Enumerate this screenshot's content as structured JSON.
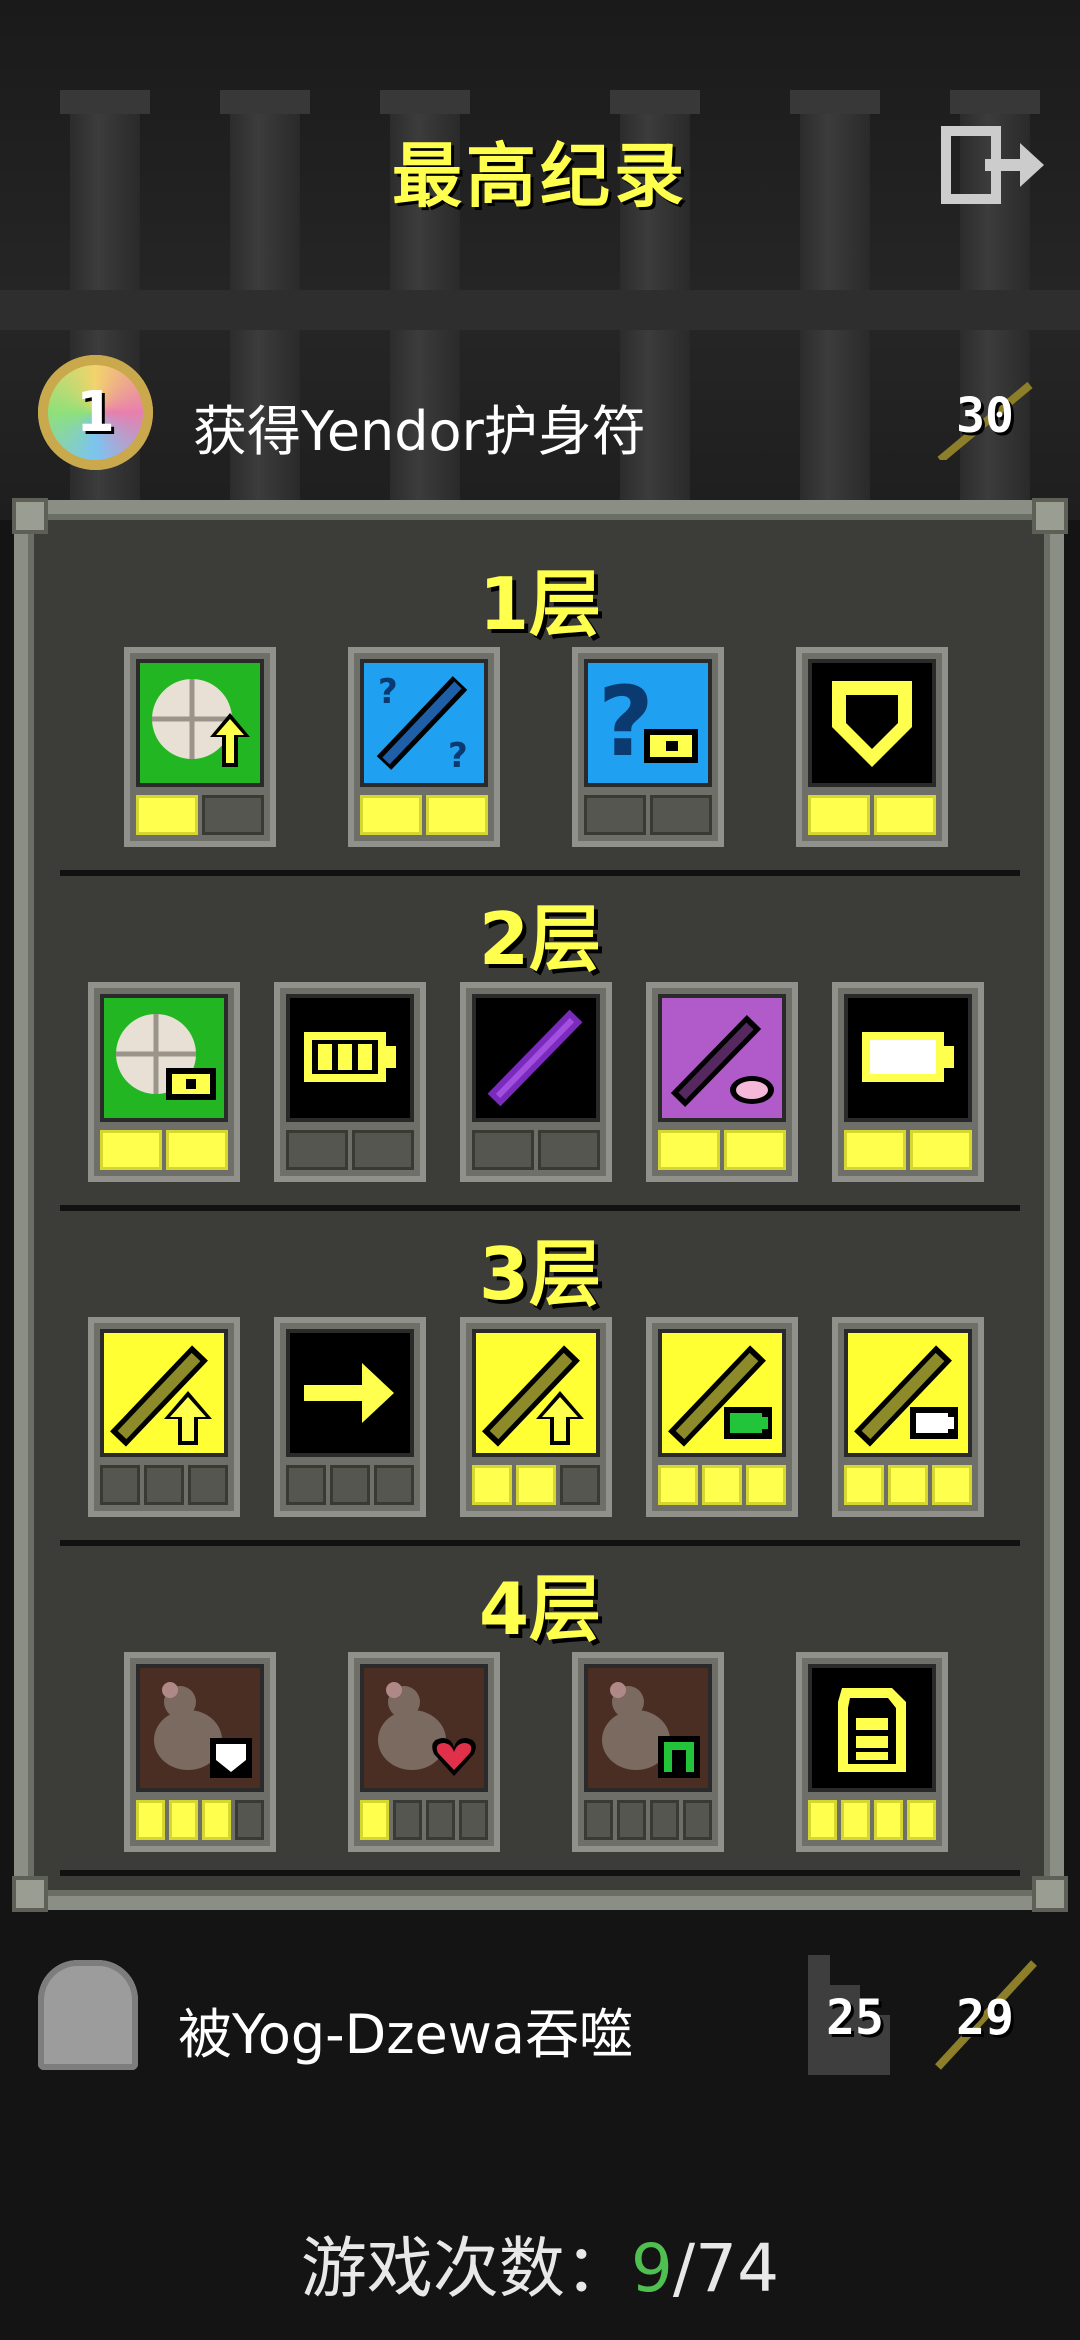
{
  "title": "最高纪录",
  "record": {
    "rank": "1",
    "description": "获得Yendor护身符",
    "level": "30"
  },
  "sections": [
    {
      "label": "1层",
      "badges": [
        {
          "icon": "unlock-tiles-up-icon",
          "slots_on": 1,
          "slots_total": 2
        },
        {
          "icon": "unknown-wand-icon",
          "slots_on": 2,
          "slots_total": 2
        },
        {
          "icon": "unknown-key-icon",
          "slots_on": 0,
          "slots_total": 2
        },
        {
          "icon": "armor-shield-icon",
          "slots_on": 2,
          "slots_total": 2
        }
      ]
    },
    {
      "label": "2层",
      "badges": [
        {
          "icon": "tiles-key-icon",
          "slots_on": 2,
          "slots_total": 2
        },
        {
          "icon": "battery-full-icon",
          "slots_on": 0,
          "slots_total": 2
        },
        {
          "icon": "purple-wand-icon",
          "slots_on": 0,
          "slots_total": 2
        },
        {
          "icon": "pink-wand-key-icon",
          "slots_on": 2,
          "slots_total": 2
        },
        {
          "icon": "battery-empty-icon",
          "slots_on": 2,
          "slots_total": 2
        }
      ]
    },
    {
      "label": "3层",
      "badges": [
        {
          "icon": "weapon-up-icon",
          "slots_on": 0,
          "slots_total": 3
        },
        {
          "icon": "arrow-right-icon",
          "slots_on": 0,
          "slots_total": 3
        },
        {
          "icon": "weapon-up-icon",
          "slots_on": 2,
          "slots_total": 3
        },
        {
          "icon": "weapon-green-icon",
          "slots_on": 3,
          "slots_total": 3
        },
        {
          "icon": "weapon-white-icon",
          "slots_on": 3,
          "slots_total": 3
        }
      ]
    },
    {
      "label": "4层",
      "badges": [
        {
          "icon": "rat-white-icon",
          "slots_on": 3,
          "slots_total": 4
        },
        {
          "icon": "rat-heart-icon",
          "slots_on": 1,
          "slots_total": 4
        },
        {
          "icon": "rat-green-icon",
          "slots_on": 0,
          "slots_total": 4
        },
        {
          "icon": "backpack-icon",
          "slots_on": 4,
          "slots_total": 4
        }
      ]
    }
  ],
  "death": {
    "description": "被Yog-Dzewa吞噬",
    "depth": "25",
    "level": "29"
  },
  "games": {
    "label": "游戏次数：",
    "current": "9",
    "total": "/74"
  },
  "colors": {
    "accent_yellow": "#ffff4d",
    "panel": "#3c3d38",
    "success_green": "#4fbf4f"
  }
}
